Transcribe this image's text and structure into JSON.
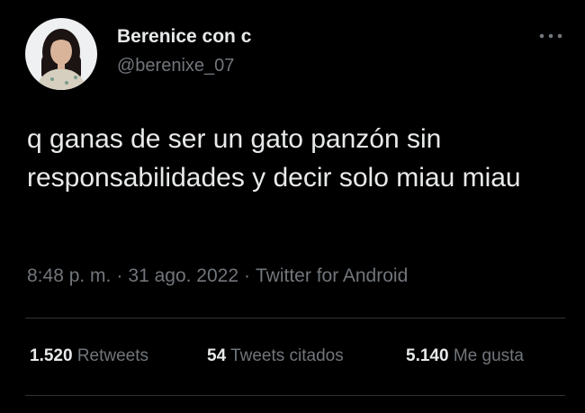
{
  "author": {
    "display_name": "Berenice con c",
    "handle": "@berenixe_07",
    "avatar_icon": "profile-photo"
  },
  "menu": {
    "icon": "more-horizontal-icon"
  },
  "tweet": {
    "text": "q ganas de ser un gato panzón sin responsabilidades y decir solo miau miau"
  },
  "meta": {
    "time": "8:48 p. m.",
    "separator": "·",
    "date": "31 ago. 2022",
    "source": "Twitter for Android"
  },
  "stats": {
    "retweets": {
      "count": "1.520",
      "label": "Retweets"
    },
    "quotes": {
      "count": "54",
      "label": "Tweets citados"
    },
    "likes": {
      "count": "5.140",
      "label": "Me gusta"
    }
  },
  "colors": {
    "background": "#000000",
    "primary_text": "#e7e9ea",
    "secondary_text": "#71767b",
    "divider": "#2f3336"
  }
}
